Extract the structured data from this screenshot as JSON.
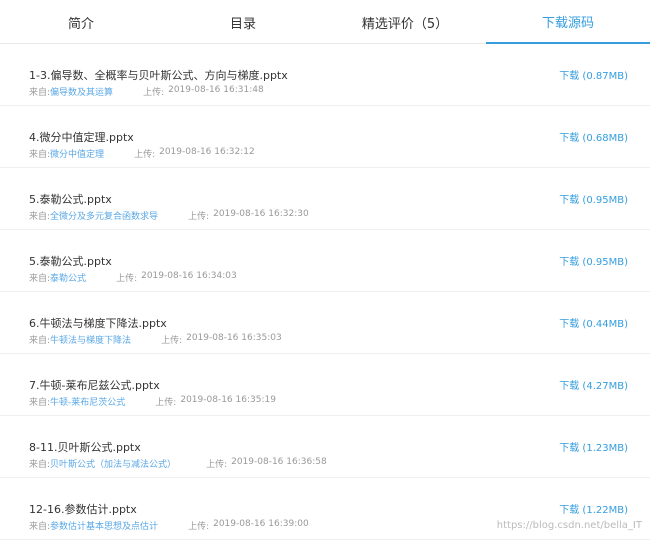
{
  "tabs": [
    "简介",
    "目录",
    "精选评价（5）",
    "下载源码"
  ],
  "active_tab": 3,
  "labels": {
    "source_prefix": "来自:",
    "upload_prefix": "上传:"
  },
  "files": [
    {
      "name": "1-3.偏导数、全概率与贝叶斯公式、方向与梯度.pptx",
      "source": "偏导数及其运算",
      "uploaded": "2019-08-16 16:31:48",
      "download": "下载 (0.87MB)"
    },
    {
      "name": "4.微分中值定理.pptx",
      "source": "微分中值定理",
      "uploaded": "2019-08-16 16:32:12",
      "download": "下载 (0.68MB)"
    },
    {
      "name": "5.泰勒公式.pptx",
      "source": "全微分及多元复合函数求导",
      "uploaded": "2019-08-16 16:32:30",
      "download": "下载 (0.95MB)"
    },
    {
      "name": "5.泰勒公式.pptx",
      "source": "泰勒公式",
      "uploaded": "2019-08-16 16:34:03",
      "download": "下载 (0.95MB)"
    },
    {
      "name": "6.牛顿法与梯度下降法.pptx",
      "source": "牛顿法与梯度下降法",
      "uploaded": "2019-08-16 16:35:03",
      "download": "下载 (0.44MB)"
    },
    {
      "name": "7.牛顿-莱布尼兹公式.pptx",
      "source": "牛顿-莱布尼茨公式",
      "uploaded": "2019-08-16 16:35:19",
      "download": "下载 (4.27MB)"
    },
    {
      "name": "8-11.贝叶斯公式.pptx",
      "source": "贝叶斯公式（加法与减法公式）",
      "uploaded": "2019-08-16 16:36:58",
      "download": "下载 (1.23MB)"
    },
    {
      "name": "12-16.参数估计.pptx",
      "source": "参数估计基本思想及点估计",
      "uploaded": "2019-08-16 16:39:00",
      "download": "下载 (1.22MB)"
    }
  ],
  "watermark": "https://blog.csdn.net/bella_IT",
  "colors": {
    "accent": "#349edf",
    "text": "#333333",
    "muted": "#999999"
  }
}
